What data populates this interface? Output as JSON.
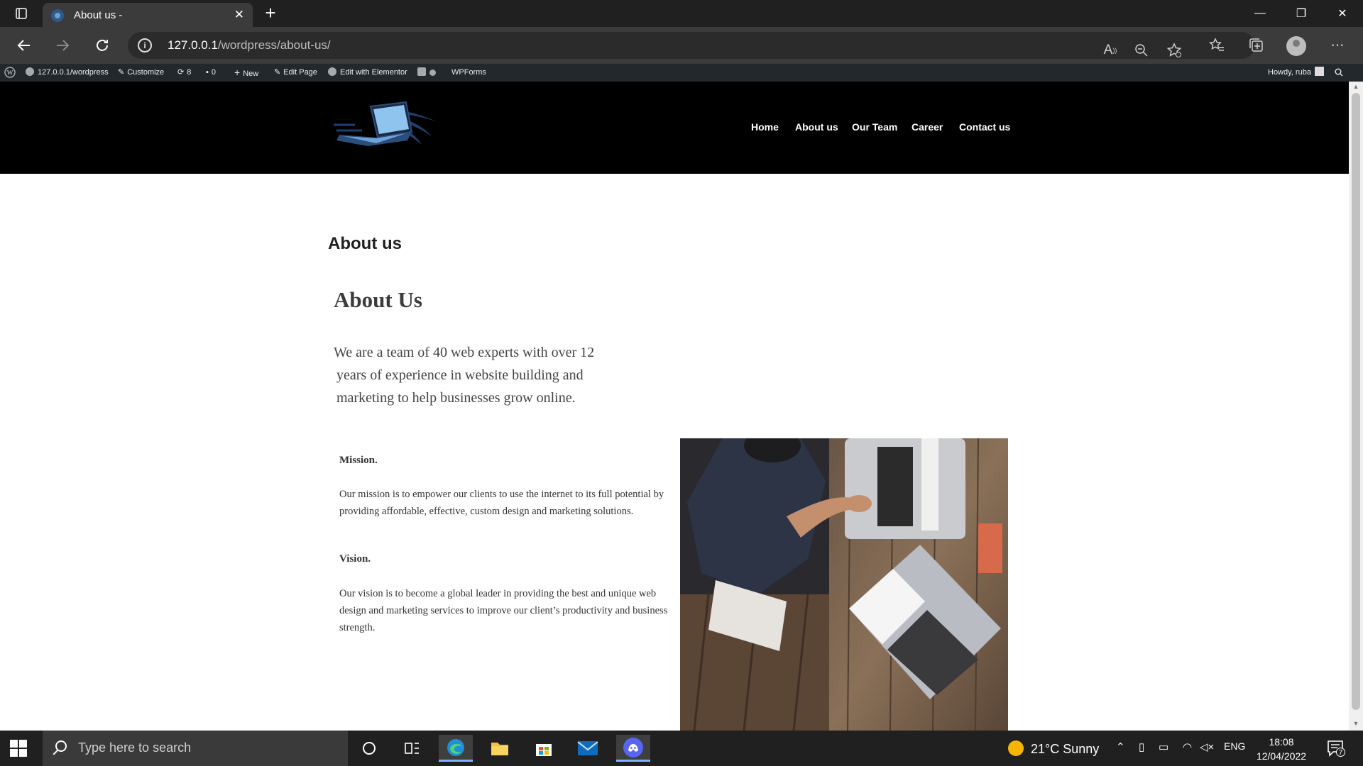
{
  "browser": {
    "tab_title": "About us -",
    "tab_close": "✕",
    "new_tab": "+",
    "url_host": "127.0.0.1",
    "url_path": "/wordpress/about-us/",
    "read_aloud": "A",
    "window_controls": {
      "minimize": "—",
      "restore": "❐",
      "close": "✕"
    },
    "icons": [
      "tab-actions-icon",
      "back-icon",
      "forward-icon",
      "refresh-icon",
      "site-info-icon",
      "read-aloud-icon",
      "zoom-out-icon",
      "add-favorite-icon",
      "favorites-icon",
      "collections-icon",
      "profile-icon",
      "more-icon"
    ]
  },
  "admin_bar": {
    "site": "127.0.0.1/wordpress",
    "customize": "Customize",
    "updates_count": "8",
    "comments_count": "0",
    "new": "New",
    "edit_page": "Edit Page",
    "edit_elementor": "Edit with Elementor",
    "wpforms": "WPForms",
    "howdy": "Howdy, ruba"
  },
  "site": {
    "nav": [
      "Home",
      "About us",
      "Our Team",
      "Career",
      "Contact us"
    ]
  },
  "content": {
    "page_title": "About us",
    "heading": "About Us",
    "intro_lines": [
      "We are a team of 40 web experts with over 12",
      " years of experience in website building and",
      " marketing to help businesses grow online."
    ],
    "mission_heading": "Mission.",
    "mission_text": "Our mission is to empower our clients to use the internet to its full potential by providing affordable, effective, custom design and marketing solutions.",
    "vision_heading": "Vision.",
    "vision_text": "Our vision is to become a global leader in providing the best and unique web design and marketing services to improve our client’s productivity and business strength."
  },
  "taskbar": {
    "search_placeholder": "Type here to search",
    "weather": "21°C  Sunny",
    "language": "ENG",
    "time": "18:08",
    "date": "12/04/2022",
    "notification_count": "7"
  }
}
